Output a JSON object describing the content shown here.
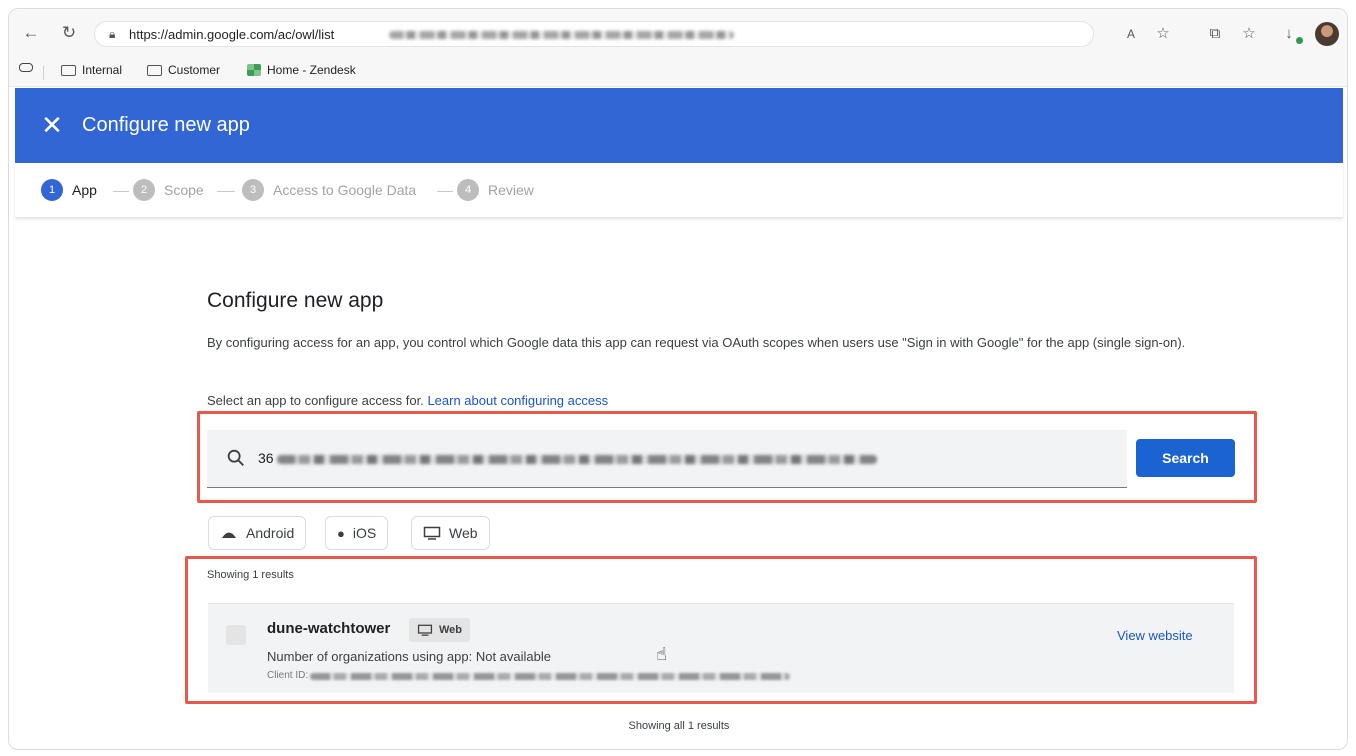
{
  "browser": {
    "url_visible": "https://admin.google.com/ac/owl/list",
    "bookmarks": [
      {
        "label": "Internal",
        "icon": "folder-icon"
      },
      {
        "label": "Customer",
        "icon": "folder-icon"
      },
      {
        "label": "Home - Zendesk",
        "icon": "zendesk-icon"
      }
    ]
  },
  "header": {
    "title": "Configure new app",
    "close_icon": "close-icon",
    "color": "#3266d4"
  },
  "stepper": {
    "steps": [
      {
        "number": "1",
        "label": "App",
        "active": true
      },
      {
        "number": "2",
        "label": "Scope",
        "active": false
      },
      {
        "number": "3",
        "label": "Access to Google Data",
        "active": false
      },
      {
        "number": "4",
        "label": "Review",
        "active": false
      }
    ]
  },
  "main": {
    "title": "Configure new app",
    "description": "By configuring access for an app, you control which Google data this app can request via OAuth scopes when users use \"Sign in with Google\" for the app (single sign-on).",
    "select_prompt": "Select an app to configure access for.",
    "learn_link": "Learn about configuring access",
    "search": {
      "value_prefix": "36",
      "button_label": "Search"
    },
    "filters": [
      {
        "label": "Android",
        "icon": "android-icon"
      },
      {
        "label": "iOS",
        "icon": "apple-icon"
      },
      {
        "label": "Web",
        "icon": "monitor-icon"
      }
    ],
    "showing_text": "Showing 1 results",
    "result": {
      "name": "dune-watchtower",
      "type_tag": "Web",
      "org_count": "Number of organizations using app: Not available",
      "client_id_label": "Client ID:",
      "view_link": "View website"
    },
    "showing_all_text": "Showing all 1 results"
  },
  "colors": {
    "accent": "#1a63d1",
    "highlight": "#e8594c"
  }
}
